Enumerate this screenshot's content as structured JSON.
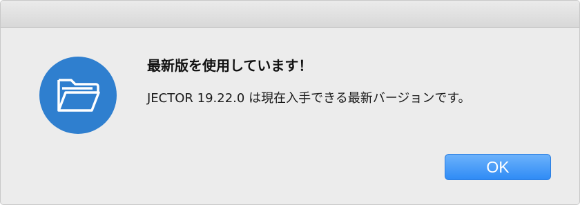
{
  "dialog": {
    "title": "最新版を使用しています！",
    "message": "JECTOR 19.22.0 は現在入手できる最新バージョンです。",
    "ok_label": "OK",
    "icon": "folder-open-icon",
    "accent_color": "#2f7fcf",
    "button_color": "#3d95f7"
  }
}
